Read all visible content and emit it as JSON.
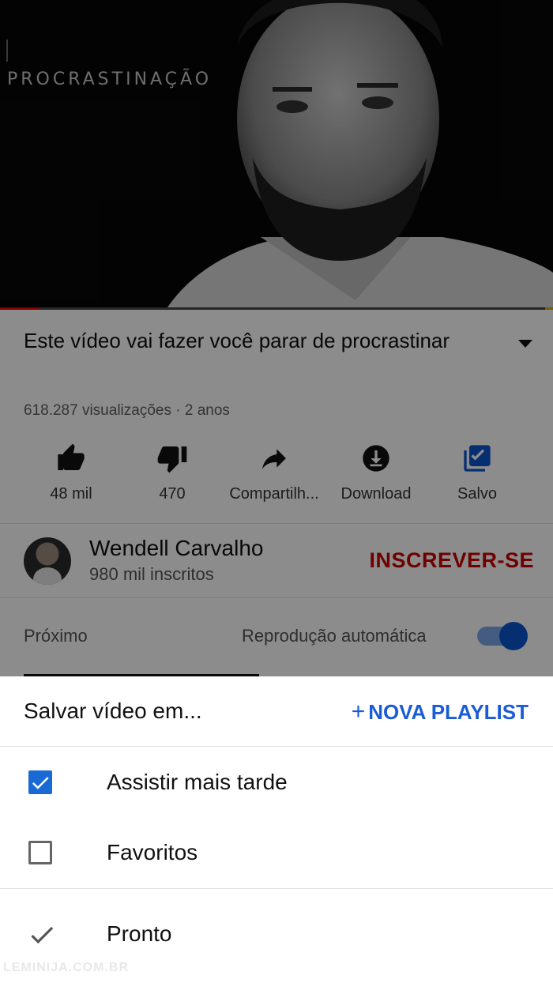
{
  "video": {
    "title_overlay": "PROCRASTINAÇÃO",
    "progress_percent": 7
  },
  "info": {
    "title": "Este vídeo vai fazer você parar de procrastinar",
    "meta": "618.287 visualizações · 2 anos"
  },
  "actions": [
    {
      "label": "48 mil",
      "icon": "thumbs-up-icon"
    },
    {
      "label": "470",
      "icon": "thumbs-down-icon"
    },
    {
      "label": "Compartilh...",
      "icon": "share-icon"
    },
    {
      "label": "Download",
      "icon": "download-icon"
    },
    {
      "label": "Salvo",
      "icon": "saved-playlist-icon"
    }
  ],
  "channel": {
    "name": "Wendell Carvalho",
    "subscribers": "980 mil inscritos",
    "subscribe_label": "INSCREVER-SE"
  },
  "up_next": {
    "label": "Próximo",
    "autoplay_label": "Reprodução automática",
    "autoplay_on": true
  },
  "sheet": {
    "title": "Salvar vídeo em...",
    "new_playlist_label": "NOVA PLAYLIST",
    "new_playlist_plus": "+",
    "items": [
      {
        "label": "Assistir mais tarde",
        "checked": true
      },
      {
        "label": "Favoritos",
        "checked": false
      }
    ],
    "done_label": "Pronto"
  },
  "watermark": "LEMINIJA.COM.BR",
  "colors": {
    "accent": "#1a5cd6",
    "subscribe": "#cc0000",
    "progress": "#ee0000"
  }
}
